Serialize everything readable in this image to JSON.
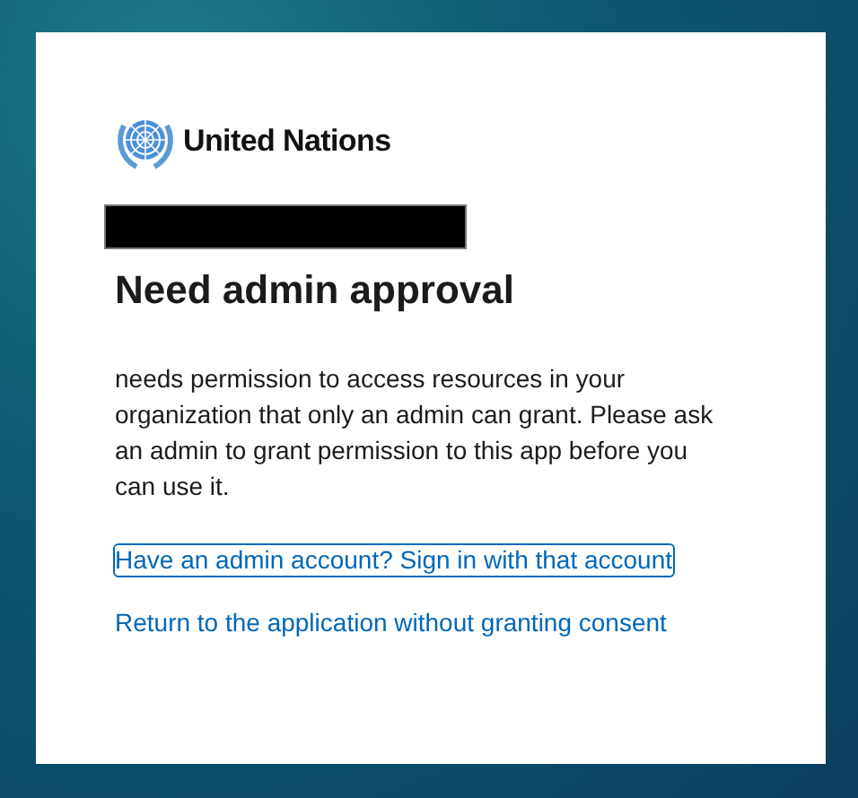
{
  "logo": {
    "text": "United Nations"
  },
  "redacted": true,
  "title": "Need admin approval",
  "message": "needs permission to access resources in your organization that only an admin can grant. Please ask an admin to grant permission to this app before you can use it.",
  "links": [
    {
      "label": "Have an admin account? Sign in with that account",
      "focused": true
    },
    {
      "label": "Return to the application without granting consent",
      "focused": false
    }
  ]
}
